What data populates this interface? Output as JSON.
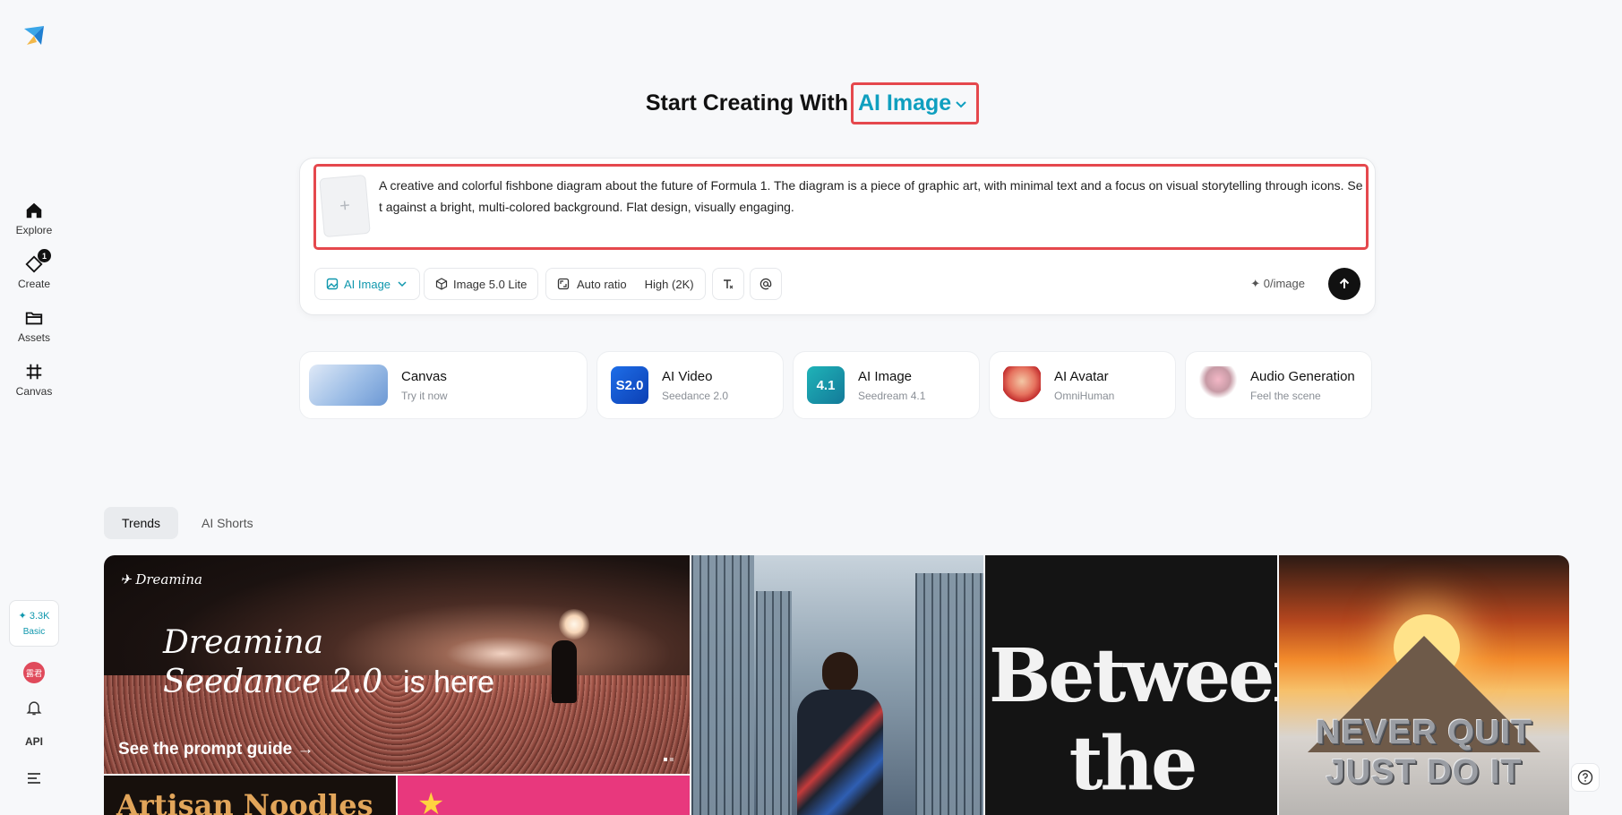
{
  "sidebar": {
    "items": [
      {
        "label": "Explore",
        "icon": "home-icon"
      },
      {
        "label": "Create",
        "icon": "create-icon",
        "badge": "1"
      },
      {
        "label": "Assets",
        "icon": "folder-icon"
      },
      {
        "label": "Canvas",
        "icon": "canvas-icon"
      }
    ],
    "credits": "✦ 3.3K",
    "plan": "Basic",
    "avatar_text": "露君",
    "api_label": "API"
  },
  "heading": {
    "static": "Start Creating With",
    "type_selected": "AI Image"
  },
  "prompt": {
    "upload_placeholder": "+",
    "text": "A creative and colorful fishbone diagram about the future of Formula 1. The diagram is a piece of graphic art, with minimal text and a focus on visual storytelling through icons. Set against a bright, multi-colored background. Flat design, visually engaging."
  },
  "toolbar": {
    "mode_label": "AI Image",
    "model_label": "Image 5.0 Lite",
    "ratio_label": "Auto ratio",
    "quality_label": "High (2K)",
    "cost_label": "✦ 0/image"
  },
  "features": [
    {
      "title": "Canvas",
      "subtitle": "Try it now"
    },
    {
      "title": "AI Video",
      "subtitle": "Seedance 2.0",
      "thumb": "S2.0"
    },
    {
      "title": "AI Image",
      "subtitle": "Seedream 4.1",
      "thumb": "4.1"
    },
    {
      "title": "AI Avatar",
      "subtitle": "OmniHuman"
    },
    {
      "title": "Audio Generation",
      "subtitle": "Feel the scene"
    }
  ],
  "tabs": [
    {
      "label": "Trends",
      "active": true
    },
    {
      "label": "AI Shorts",
      "active": false
    }
  ],
  "gallery": {
    "banner": {
      "brand": "Dreamina",
      "title_line1": "Dreamina",
      "title_line2": "Seedance 2.0",
      "title_suffix": "is here",
      "link": "See the prompt guide →"
    },
    "noodles_text": "Artisan Noodles",
    "between_text": "Between the",
    "mountain_text_1": "NEVER QUIT",
    "mountain_text_2": "JUST DO IT"
  },
  "colors": {
    "accent": "#0f9fbf",
    "highlight_border": "#e5484d"
  }
}
